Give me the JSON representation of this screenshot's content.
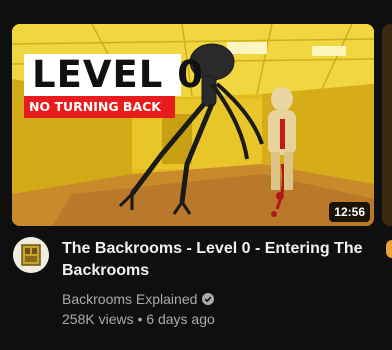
{
  "video": {
    "thumbnail": {
      "headline": "LEVEL 0",
      "subline": "NO TURNING BACK",
      "duration": "12:56"
    },
    "title": "The Backrooms - Level 0 - Entering The Backrooms",
    "channel": {
      "name": "Backrooms Explained",
      "verified": true,
      "avatar_icon": "backrooms-logo-icon"
    },
    "views": "258K views",
    "separator": "•",
    "age": "6 days ago"
  },
  "colors": {
    "background": "#0f0f0f",
    "title_text": "#f1f1f1",
    "secondary_text": "#aaaaaa",
    "banner_red": "#e81c1c",
    "wall_yellow": "#e8c21f"
  }
}
